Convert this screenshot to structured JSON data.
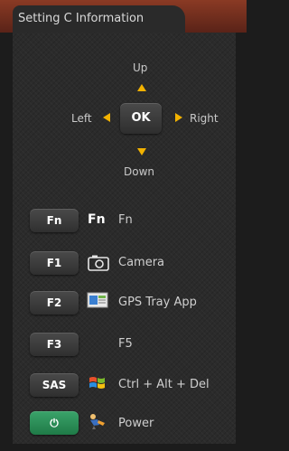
{
  "window": {
    "title": "Setting C Information"
  },
  "dpad": {
    "up_label": "Up",
    "down_label": "Down",
    "left_label": "Left",
    "right_label": "Right",
    "ok_label": "OK",
    "arrow_color": "#f2b200"
  },
  "buttons": [
    {
      "key_label": "Fn",
      "icon_text": "Fn",
      "icon": "fn-text",
      "action_label": "Fn"
    },
    {
      "key_label": "F1",
      "icon": "camera-icon",
      "action_label": "Camera"
    },
    {
      "key_label": "F2",
      "icon": "gps-tray-app-icon",
      "action_label": "GPS Tray App"
    },
    {
      "key_label": "F3",
      "icon": "",
      "action_label": "F5"
    },
    {
      "key_label": "SAS",
      "icon": "windows-flag-icon",
      "action_label": "Ctrl + Alt + Del"
    },
    {
      "key_label": "⏻",
      "icon": "power-figure-icon",
      "action_label": "Power"
    }
  ],
  "colors": {
    "power_button": "#2e8f58",
    "top_bar": "#6e2c1c"
  }
}
